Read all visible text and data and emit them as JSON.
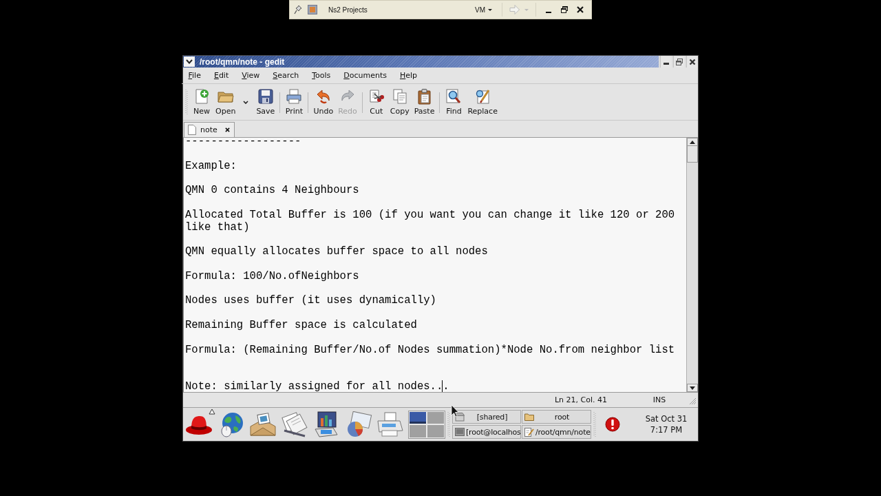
{
  "session_bar": {
    "title": "Ns2 Projects",
    "menu": "VM",
    "forward_button": {
      "disabled": true
    }
  },
  "window": {
    "title": "/root/qmn/note - gedit"
  },
  "menu": [
    "File",
    "Edit",
    "View",
    "Search",
    "Tools",
    "Documents",
    "Help"
  ],
  "toolbar": {
    "groups": [
      [
        {
          "kind": "button",
          "label": "New",
          "disabled": false
        },
        {
          "kind": "button",
          "label": "Open",
          "disabled": false
        },
        {
          "kind": "dropdown"
        },
        {
          "kind": "button",
          "label": "Save",
          "disabled": false
        }
      ],
      [
        {
          "kind": "button",
          "label": "Print",
          "disabled": false
        }
      ],
      [
        {
          "kind": "button",
          "label": "Undo",
          "disabled": false
        },
        {
          "kind": "button",
          "label": "Redo",
          "disabled": true
        }
      ],
      [
        {
          "kind": "button",
          "label": "Cut",
          "disabled": false
        },
        {
          "kind": "button",
          "label": "Copy",
          "disabled": false
        },
        {
          "kind": "button",
          "label": "Paste",
          "disabled": false
        }
      ],
      [
        {
          "kind": "button",
          "label": "Find",
          "disabled": false
        },
        {
          "kind": "button",
          "label": "Replace",
          "disabled": false
        }
      ]
    ]
  },
  "tabs": [
    {
      "label": "note",
      "selected": true
    }
  ],
  "editor": {
    "lines": [
      {
        "kind": "text",
        "text": "------------------"
      },
      {
        "kind": "blank"
      },
      {
        "kind": "text",
        "text": "Example:"
      },
      {
        "kind": "blank"
      },
      {
        "kind": "text",
        "text": "QMN 0 contains 4 Neighbours"
      },
      {
        "kind": "blank"
      },
      {
        "kind": "text",
        "text": "Allocated Total Buffer is 100 (if you want you can change it like 120 or 200 like that)"
      },
      {
        "kind": "blank"
      },
      {
        "kind": "text",
        "text": "QMN equally allocates buffer space to all nodes"
      },
      {
        "kind": "blank"
      },
      {
        "kind": "text",
        "text": "Formula: 100/No.ofNeighbors"
      },
      {
        "kind": "blank"
      },
      {
        "kind": "text",
        "text": "Nodes uses buffer (it uses dynamically)"
      },
      {
        "kind": "blank"
      },
      {
        "kind": "text",
        "text": "Remaining Buffer space is calculated"
      },
      {
        "kind": "blank"
      },
      {
        "kind": "text",
        "text": "Formula: (Remaining Buffer/No.of Nodes summation)*Node No.from neighbor list"
      },
      {
        "kind": "blank"
      },
      {
        "kind": "blank"
      },
      {
        "kind": "cursor",
        "before_cursor": "Note: similarly assigned for all nodes..",
        "after_cursor": "."
      }
    ]
  },
  "status_bar": {
    "position": "Ln 21, Col. 41",
    "mode": "INS"
  },
  "panel": {
    "workspaces": [
      {
        "selected": true
      },
      {
        "selected": false
      },
      {
        "selected": false
      },
      {
        "selected": false
      }
    ],
    "tasks": [
      {
        "label": "[shared]"
      },
      {
        "label": "root"
      },
      {
        "label": "[root@localhos"
      },
      {
        "label": "/root/qmn/note"
      }
    ],
    "clock": {
      "date": "Sat Oct 31",
      "time": "7:17 PM"
    }
  }
}
